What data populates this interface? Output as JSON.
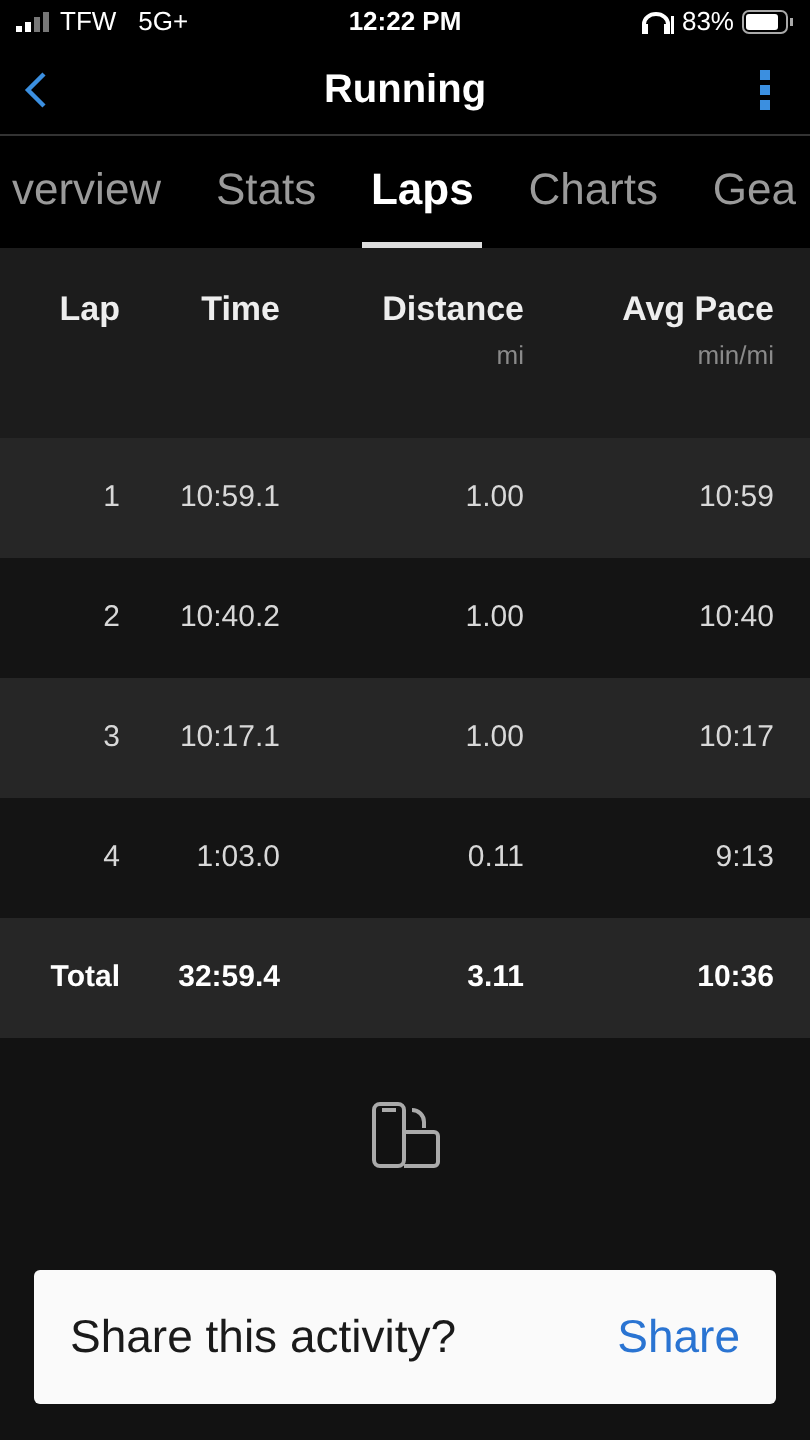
{
  "status_bar": {
    "carrier": "TFW",
    "network": "5G+",
    "time": "12:22 PM",
    "battery": "83%"
  },
  "nav": {
    "title": "Running"
  },
  "tabs": [
    {
      "label": "verview",
      "selected": false
    },
    {
      "label": "Stats",
      "selected": false
    },
    {
      "label": "Laps",
      "selected": true
    },
    {
      "label": "Charts",
      "selected": false
    },
    {
      "label": "Gea",
      "selected": false
    }
  ],
  "table": {
    "columns": [
      {
        "label": "Lap"
      },
      {
        "label": "Time"
      },
      {
        "label": "Distance",
        "unit": "mi"
      },
      {
        "label": "Avg Pace",
        "unit": "min/mi"
      }
    ],
    "rows": [
      {
        "kind": "lap",
        "cells": [
          "1",
          "10:59.1",
          "1.00",
          "10:59"
        ]
      },
      {
        "kind": "lap",
        "cells": [
          "2",
          "10:40.2",
          "1.00",
          "10:40"
        ]
      },
      {
        "kind": "lap",
        "cells": [
          "3",
          "10:17.1",
          "1.00",
          "10:17"
        ]
      },
      {
        "kind": "lap",
        "cells": [
          "4",
          "1:03.0",
          "0.11",
          "9:13"
        ]
      },
      {
        "kind": "total",
        "cells": [
          "Total",
          "32:59.4",
          "3.11",
          "10:36"
        ]
      }
    ]
  },
  "share": {
    "prompt": "Share this activity?",
    "action": "Share"
  }
}
